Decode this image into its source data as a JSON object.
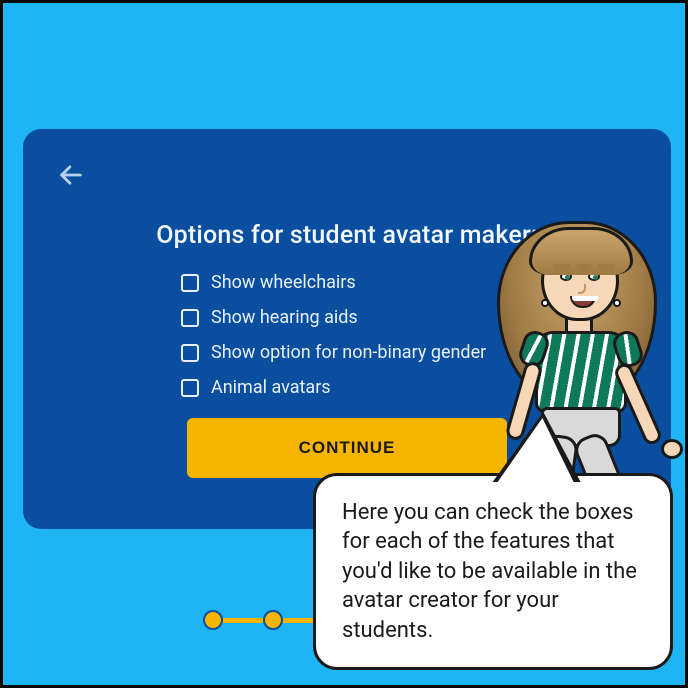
{
  "card": {
    "title": "Options for student avatar maker:",
    "options": [
      "Show wheelchairs",
      "Show hearing aids",
      "Show option for non-binary gender",
      "Animal avatars"
    ],
    "continue_label": "CONTINUE"
  },
  "tooltip": {
    "text": "Here you can check the boxes for each of the features that you'd like to be available in the avatar creator for your students."
  },
  "icons": {
    "back": "back-arrow-icon"
  },
  "colors": {
    "page_bg": "#1fb5f5",
    "card_bg": "#0a4ea0",
    "accent": "#f7b500",
    "text_light": "#ffffff"
  }
}
